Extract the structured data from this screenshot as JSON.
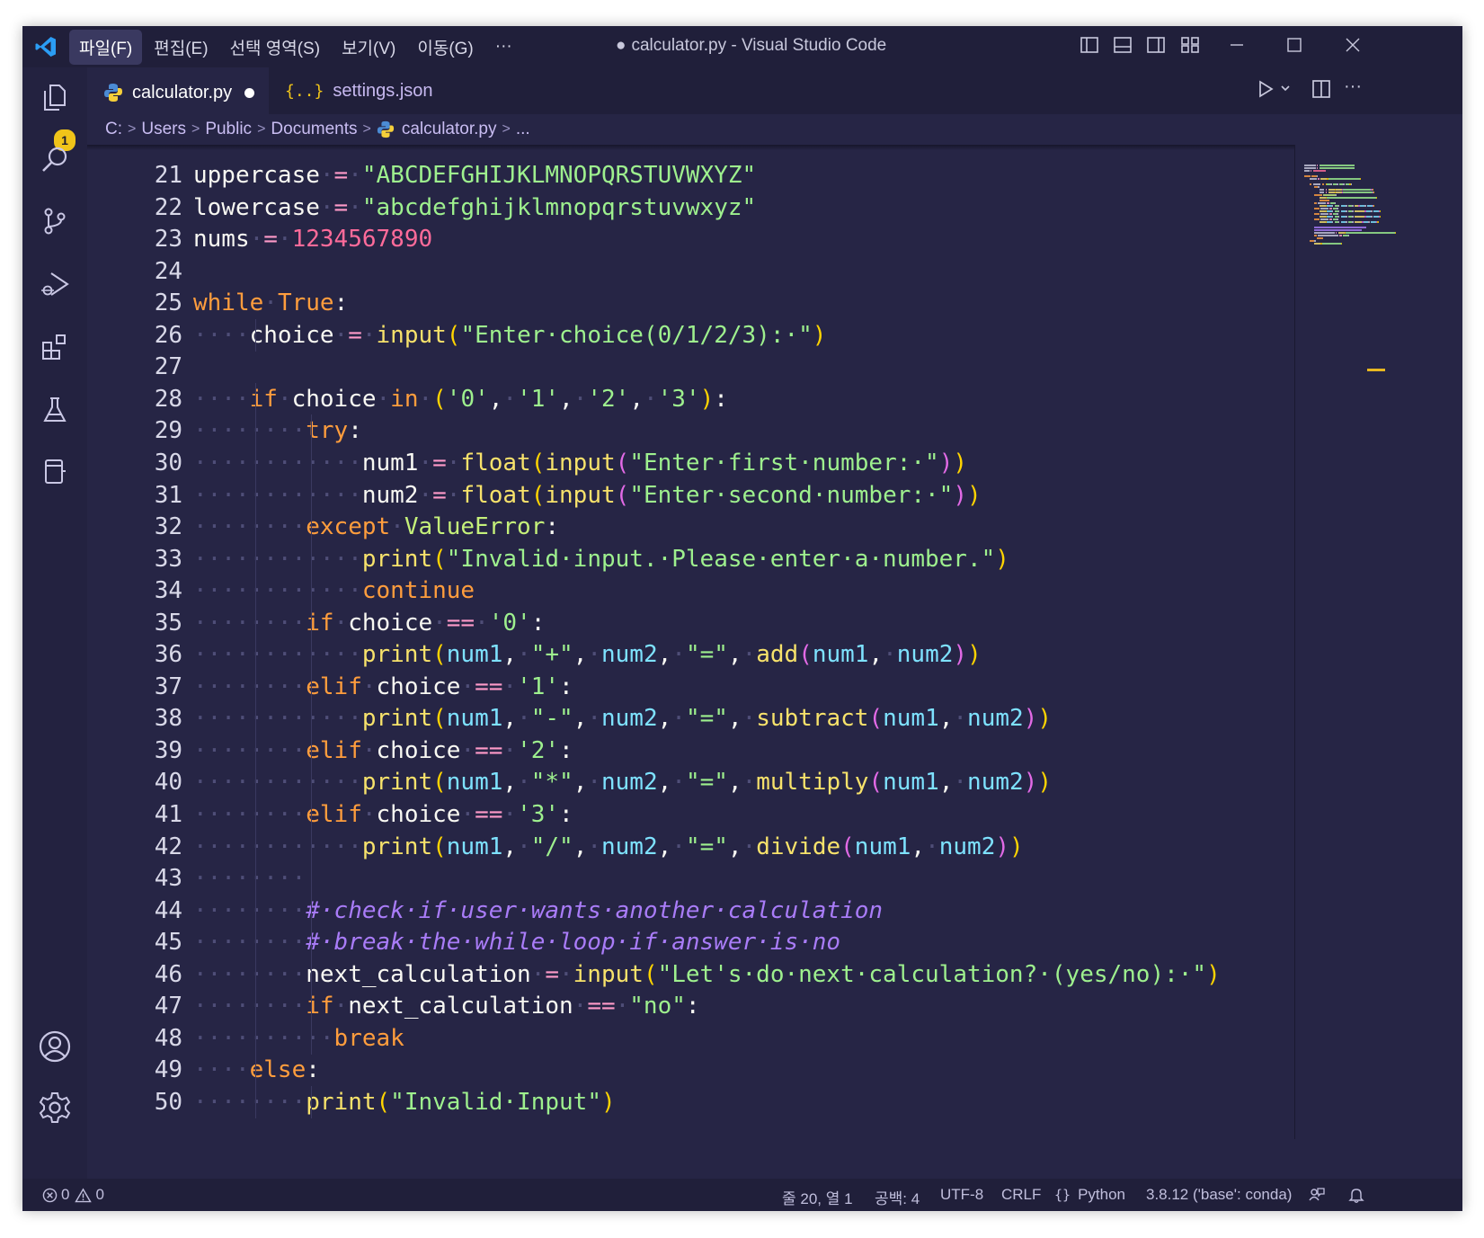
{
  "window": {
    "title": "calculator.py - Visual Studio Code",
    "modified_dot": "●"
  },
  "menu": [
    "파일(F)",
    "편집(E)",
    "선택 영역(S)",
    "보기(V)",
    "이동(G)",
    "···"
  ],
  "activity": {
    "badge": "1",
    "icons": [
      "explorer-icon",
      "search-icon",
      "source-control-icon",
      "run-debug-icon",
      "extensions-icon",
      "testing-icon",
      "remote-icon",
      "accounts-icon",
      "manage-gear-icon"
    ]
  },
  "tabs": [
    {
      "label": "calculator.py",
      "icon": "python-icon",
      "modified": true,
      "active": true
    },
    {
      "label": "settings.json",
      "icon": "json-braces-icon",
      "modified": false,
      "active": false
    }
  ],
  "breadcrumb": [
    "C:",
    "Users",
    "Public",
    "Documents",
    "calculator.py",
    "..."
  ],
  "editor": {
    "lines": [
      {
        "n": "21",
        "tokens": [
          [
            "uppercase",
            "plain"
          ],
          [
            "·",
            "w"
          ],
          [
            "=",
            "op"
          ],
          [
            "·",
            "w"
          ],
          [
            "\"ABCDEFGHIJKLMNOPQRSTUVWXYZ\"",
            "str"
          ]
        ]
      },
      {
        "n": "22",
        "tokens": [
          [
            "lowercase",
            "plain"
          ],
          [
            "·",
            "w"
          ],
          [
            "=",
            "op"
          ],
          [
            "·",
            "w"
          ],
          [
            "\"abcdefghijklmnopqrstuvwxyz\"",
            "str"
          ]
        ]
      },
      {
        "n": "23",
        "tokens": [
          [
            "nums",
            "plain"
          ],
          [
            "·",
            "w"
          ],
          [
            "=",
            "op"
          ],
          [
            "·",
            "w"
          ],
          [
            "1234567890",
            "num"
          ]
        ]
      },
      {
        "n": "24",
        "tokens": []
      },
      {
        "n": "25",
        "tokens": [
          [
            "while",
            "kw"
          ],
          [
            "·",
            "w"
          ],
          [
            "True",
            "kw"
          ],
          [
            ":",
            "plain"
          ]
        ]
      },
      {
        "n": "26",
        "tokens": [
          [
            "····",
            "w"
          ],
          [
            "choice",
            "plain"
          ],
          [
            "·",
            "w"
          ],
          [
            "=",
            "op"
          ],
          [
            "·",
            "w"
          ],
          [
            "input",
            "fn"
          ],
          [
            "(",
            "p1"
          ],
          [
            "\"Enter·choice(0/1/2/3):·\"",
            "str"
          ],
          [
            ")",
            "p1"
          ]
        ]
      },
      {
        "n": "27",
        "tokens": []
      },
      {
        "n": "28",
        "tokens": [
          [
            "····",
            "w"
          ],
          [
            "if",
            "kw"
          ],
          [
            "·",
            "w"
          ],
          [
            "choice",
            "plain"
          ],
          [
            "·",
            "w"
          ],
          [
            "in",
            "kw"
          ],
          [
            "·",
            "w"
          ],
          [
            "(",
            "p1"
          ],
          [
            "'0'",
            "str"
          ],
          [
            ",",
            "plain"
          ],
          [
            "·",
            "w"
          ],
          [
            "'1'",
            "str"
          ],
          [
            ",",
            "plain"
          ],
          [
            "·",
            "w"
          ],
          [
            "'2'",
            "str"
          ],
          [
            ",",
            "plain"
          ],
          [
            "·",
            "w"
          ],
          [
            "'3'",
            "str"
          ],
          [
            ")",
            "p1"
          ],
          [
            ":",
            "plain"
          ]
        ]
      },
      {
        "n": "29",
        "tokens": [
          [
            "········",
            "w"
          ],
          [
            "try",
            "kw"
          ],
          [
            ":",
            "plain"
          ]
        ]
      },
      {
        "n": "30",
        "tokens": [
          [
            "············",
            "w"
          ],
          [
            "num1",
            "plain"
          ],
          [
            "·",
            "w"
          ],
          [
            "=",
            "op"
          ],
          [
            "·",
            "w"
          ],
          [
            "float",
            "fn"
          ],
          [
            "(",
            "p1"
          ],
          [
            "input",
            "fn"
          ],
          [
            "(",
            "p2"
          ],
          [
            "\"Enter·first·number:·\"",
            "str"
          ],
          [
            ")",
            "p2"
          ],
          [
            ")",
            "p1"
          ]
        ]
      },
      {
        "n": "31",
        "tokens": [
          [
            "············",
            "w"
          ],
          [
            "num2",
            "plain"
          ],
          [
            "·",
            "w"
          ],
          [
            "=",
            "op"
          ],
          [
            "·",
            "w"
          ],
          [
            "float",
            "fn"
          ],
          [
            "(",
            "p1"
          ],
          [
            "input",
            "fn"
          ],
          [
            "(",
            "p2"
          ],
          [
            "\"Enter·second·number:·\"",
            "str"
          ],
          [
            ")",
            "p2"
          ],
          [
            ")",
            "p1"
          ]
        ]
      },
      {
        "n": "32",
        "tokens": [
          [
            "········",
            "w"
          ],
          [
            "except",
            "kw"
          ],
          [
            "·",
            "w"
          ],
          [
            "ValueError",
            "cls"
          ],
          [
            ":",
            "plain"
          ]
        ]
      },
      {
        "n": "33",
        "tokens": [
          [
            "············",
            "w"
          ],
          [
            "print",
            "fn"
          ],
          [
            "(",
            "p1"
          ],
          [
            "\"Invalid·input.·Please·enter·a·number.\"",
            "str"
          ],
          [
            ")",
            "p1"
          ]
        ]
      },
      {
        "n": "34",
        "tokens": [
          [
            "············",
            "w"
          ],
          [
            "continue",
            "kw"
          ]
        ]
      },
      {
        "n": "35",
        "tokens": [
          [
            "········",
            "w"
          ],
          [
            "if",
            "kw"
          ],
          [
            "·",
            "w"
          ],
          [
            "choice",
            "plain"
          ],
          [
            "·",
            "w"
          ],
          [
            "==",
            "op"
          ],
          [
            "·",
            "w"
          ],
          [
            "'0'",
            "str"
          ],
          [
            ":",
            "plain"
          ]
        ]
      },
      {
        "n": "36",
        "tokens": [
          [
            "············",
            "w"
          ],
          [
            "print",
            "fn"
          ],
          [
            "(",
            "p1"
          ],
          [
            "num1",
            "var"
          ],
          [
            ",",
            "plain"
          ],
          [
            "·",
            "w"
          ],
          [
            "\"+\"",
            "str"
          ],
          [
            ",",
            "plain"
          ],
          [
            "·",
            "w"
          ],
          [
            "num2",
            "var"
          ],
          [
            ",",
            "plain"
          ],
          [
            "·",
            "w"
          ],
          [
            "\"=\"",
            "str"
          ],
          [
            ",",
            "plain"
          ],
          [
            "·",
            "w"
          ],
          [
            "add",
            "fn"
          ],
          [
            "(",
            "p2"
          ],
          [
            "num1",
            "var"
          ],
          [
            ",",
            "plain"
          ],
          [
            "·",
            "w"
          ],
          [
            "num2",
            "var"
          ],
          [
            ")",
            "p2"
          ],
          [
            ")",
            "p1"
          ]
        ]
      },
      {
        "n": "37",
        "tokens": [
          [
            "········",
            "w"
          ],
          [
            "elif",
            "kw"
          ],
          [
            "·",
            "w"
          ],
          [
            "choice",
            "plain"
          ],
          [
            "·",
            "w"
          ],
          [
            "==",
            "op"
          ],
          [
            "·",
            "w"
          ],
          [
            "'1'",
            "str"
          ],
          [
            ":",
            "plain"
          ]
        ]
      },
      {
        "n": "38",
        "tokens": [
          [
            "············",
            "w"
          ],
          [
            "print",
            "fn"
          ],
          [
            "(",
            "p1"
          ],
          [
            "num1",
            "var"
          ],
          [
            ",",
            "plain"
          ],
          [
            "·",
            "w"
          ],
          [
            "\"-\"",
            "str"
          ],
          [
            ",",
            "plain"
          ],
          [
            "·",
            "w"
          ],
          [
            "num2",
            "var"
          ],
          [
            ",",
            "plain"
          ],
          [
            "·",
            "w"
          ],
          [
            "\"=\"",
            "str"
          ],
          [
            ",",
            "plain"
          ],
          [
            "·",
            "w"
          ],
          [
            "subtract",
            "fn"
          ],
          [
            "(",
            "p2"
          ],
          [
            "num1",
            "var"
          ],
          [
            ",",
            "plain"
          ],
          [
            "·",
            "w"
          ],
          [
            "num2",
            "var"
          ],
          [
            ")",
            "p2"
          ],
          [
            ")",
            "p1"
          ]
        ]
      },
      {
        "n": "39",
        "tokens": [
          [
            "········",
            "w"
          ],
          [
            "elif",
            "kw"
          ],
          [
            "·",
            "w"
          ],
          [
            "choice",
            "plain"
          ],
          [
            "·",
            "w"
          ],
          [
            "==",
            "op"
          ],
          [
            "·",
            "w"
          ],
          [
            "'2'",
            "str"
          ],
          [
            ":",
            "plain"
          ]
        ]
      },
      {
        "n": "40",
        "tokens": [
          [
            "············",
            "w"
          ],
          [
            "print",
            "fn"
          ],
          [
            "(",
            "p1"
          ],
          [
            "num1",
            "var"
          ],
          [
            ",",
            "plain"
          ],
          [
            "·",
            "w"
          ],
          [
            "\"*\"",
            "str"
          ],
          [
            ",",
            "plain"
          ],
          [
            "·",
            "w"
          ],
          [
            "num2",
            "var"
          ],
          [
            ",",
            "plain"
          ],
          [
            "·",
            "w"
          ],
          [
            "\"=\"",
            "str"
          ],
          [
            ",",
            "plain"
          ],
          [
            "·",
            "w"
          ],
          [
            "multiply",
            "fn"
          ],
          [
            "(",
            "p2"
          ],
          [
            "num1",
            "var"
          ],
          [
            ",",
            "plain"
          ],
          [
            "·",
            "w"
          ],
          [
            "num2",
            "var"
          ],
          [
            ")",
            "p2"
          ],
          [
            ")",
            "p1"
          ]
        ]
      },
      {
        "n": "41",
        "tokens": [
          [
            "········",
            "w"
          ],
          [
            "elif",
            "kw"
          ],
          [
            "·",
            "w"
          ],
          [
            "choice",
            "plain"
          ],
          [
            "·",
            "w"
          ],
          [
            "==",
            "op"
          ],
          [
            "·",
            "w"
          ],
          [
            "'3'",
            "str"
          ],
          [
            ":",
            "plain"
          ]
        ]
      },
      {
        "n": "42",
        "tokens": [
          [
            "············",
            "w"
          ],
          [
            "print",
            "fn"
          ],
          [
            "(",
            "p1"
          ],
          [
            "num1",
            "var"
          ],
          [
            ",",
            "plain"
          ],
          [
            "·",
            "w"
          ],
          [
            "\"/\"",
            "str"
          ],
          [
            ",",
            "plain"
          ],
          [
            "·",
            "w"
          ],
          [
            "num2",
            "var"
          ],
          [
            ",",
            "plain"
          ],
          [
            "·",
            "w"
          ],
          [
            "\"=\"",
            "str"
          ],
          [
            ",",
            "plain"
          ],
          [
            "·",
            "w"
          ],
          [
            "divide",
            "fn"
          ],
          [
            "(",
            "p2"
          ],
          [
            "num1",
            "var"
          ],
          [
            ",",
            "plain"
          ],
          [
            "·",
            "w"
          ],
          [
            "num2",
            "var"
          ],
          [
            ")",
            "p2"
          ],
          [
            ")",
            "p1"
          ]
        ]
      },
      {
        "n": "43",
        "tokens": [
          [
            "········",
            "w"
          ]
        ]
      },
      {
        "n": "44",
        "tokens": [
          [
            "········",
            "w"
          ],
          [
            "#·check·if·user·wants·another·calculation",
            "cm"
          ]
        ]
      },
      {
        "n": "45",
        "tokens": [
          [
            "········",
            "w"
          ],
          [
            "#·break·the·while·loop·if·answer·is·no",
            "cm"
          ]
        ]
      },
      {
        "n": "46",
        "tokens": [
          [
            "········",
            "w"
          ],
          [
            "next_calculation",
            "plain"
          ],
          [
            "·",
            "w"
          ],
          [
            "=",
            "op"
          ],
          [
            "·",
            "w"
          ],
          [
            "input",
            "fn"
          ],
          [
            "(",
            "p1"
          ],
          [
            "\"Let's·do·next·calculation?·(yes/no):·\"",
            "str"
          ],
          [
            ")",
            "p1"
          ]
        ]
      },
      {
        "n": "47",
        "tokens": [
          [
            "········",
            "w"
          ],
          [
            "if",
            "kw"
          ],
          [
            "·",
            "w"
          ],
          [
            "next_calculation",
            "plain"
          ],
          [
            "·",
            "w"
          ],
          [
            "==",
            "op"
          ],
          [
            "·",
            "w"
          ],
          [
            "\"no\"",
            "str"
          ],
          [
            ":",
            "plain"
          ]
        ]
      },
      {
        "n": "48",
        "tokens": [
          [
            "··········",
            "w"
          ],
          [
            "break",
            "kw"
          ]
        ]
      },
      {
        "n": "49",
        "tokens": [
          [
            "····",
            "w"
          ],
          [
            "else",
            "kw"
          ],
          [
            ":",
            "plain"
          ]
        ]
      },
      {
        "n": "50",
        "tokens": [
          [
            "········",
            "w"
          ],
          [
            "print",
            "fn"
          ],
          [
            "(",
            "p1"
          ],
          [
            "\"Invalid·Input\"",
            "str"
          ],
          [
            ")",
            "p1"
          ]
        ]
      }
    ]
  },
  "status": {
    "errors": "0",
    "warnings": "0",
    "position": "줄 20, 열 1",
    "spaces": "공백: 4",
    "encoding": "UTF-8",
    "eol": "CRLF",
    "language": "Python",
    "interpreter": "3.8.12 ('base': conda)"
  },
  "colors": {
    "background": "#262545",
    "chrome": "#201f3a",
    "keyword": "#ff9d3d",
    "string": "#9ef08e",
    "number": "#ff6b9a",
    "function": "#f7e26b",
    "comment": "#a97cf8",
    "badge": "#f0c419"
  }
}
